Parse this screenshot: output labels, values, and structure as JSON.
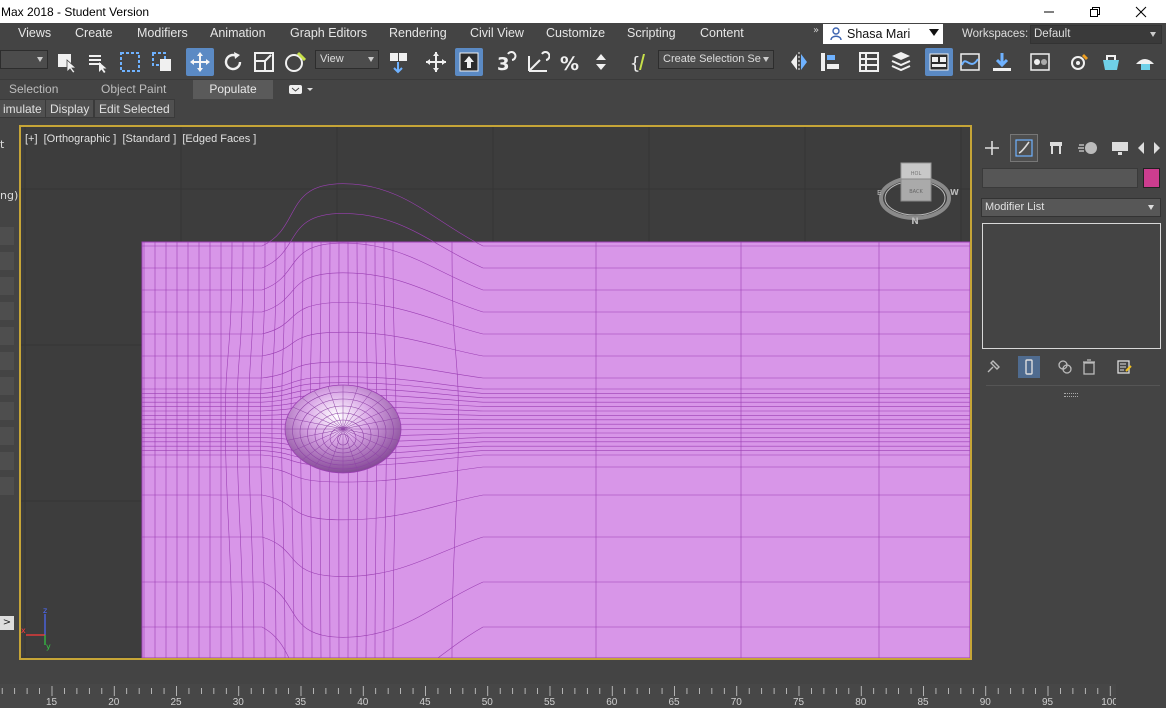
{
  "window": {
    "title": "Max 2018 - Student Version",
    "controls": [
      "minimize-icon",
      "restore-icon",
      "close-icon"
    ]
  },
  "menu": {
    "items": [
      "Views",
      "Create",
      "Modifiers",
      "Animation",
      "Graph Editors",
      "Rendering",
      "Civil View",
      "Customize",
      "Scripting",
      "Content"
    ],
    "overflow_glyph": "»",
    "user": "Shasa Mari",
    "workspaces_label": "Workspaces:",
    "workspace_value": "Default"
  },
  "toolbar": {
    "ref_coord_value": "View",
    "named_selection_value": "Create Selection Se",
    "active_tool": "select-and-move"
  },
  "ribbon": {
    "tabs": [
      "Selection",
      "Object Paint",
      "Populate"
    ],
    "active_tab": "Populate",
    "subtabs": [
      "imulate",
      "Display",
      "Edit Selected"
    ]
  },
  "left_strip": {
    "labels": [
      "t",
      "ng)"
    ],
    "expand_glyph": ">"
  },
  "viewport": {
    "labels": [
      "[+]",
      "[Orthographic ]",
      "[Standard ]",
      "[Edged Faces ]"
    ],
    "viewcube_face": "BACK",
    "viewcube_top": "HOL",
    "compass_north": "N",
    "compass_east": "W",
    "compass_west": "E",
    "axis_labels": {
      "x": "x",
      "y": "y",
      "z": "z"
    },
    "mesh_color": "#d896e8",
    "wire_color": "#9b3fb3",
    "frame_color": "#c6a537"
  },
  "command_panel": {
    "modifier_list_label": "Modifier List",
    "object_color": "#cc3d8f"
  },
  "timeline": {
    "ticks": [
      "15",
      "20",
      "25",
      "30",
      "35",
      "40",
      "45",
      "50",
      "55",
      "60",
      "65",
      "70",
      "75",
      "80",
      "85",
      "90",
      "95",
      "100"
    ]
  }
}
